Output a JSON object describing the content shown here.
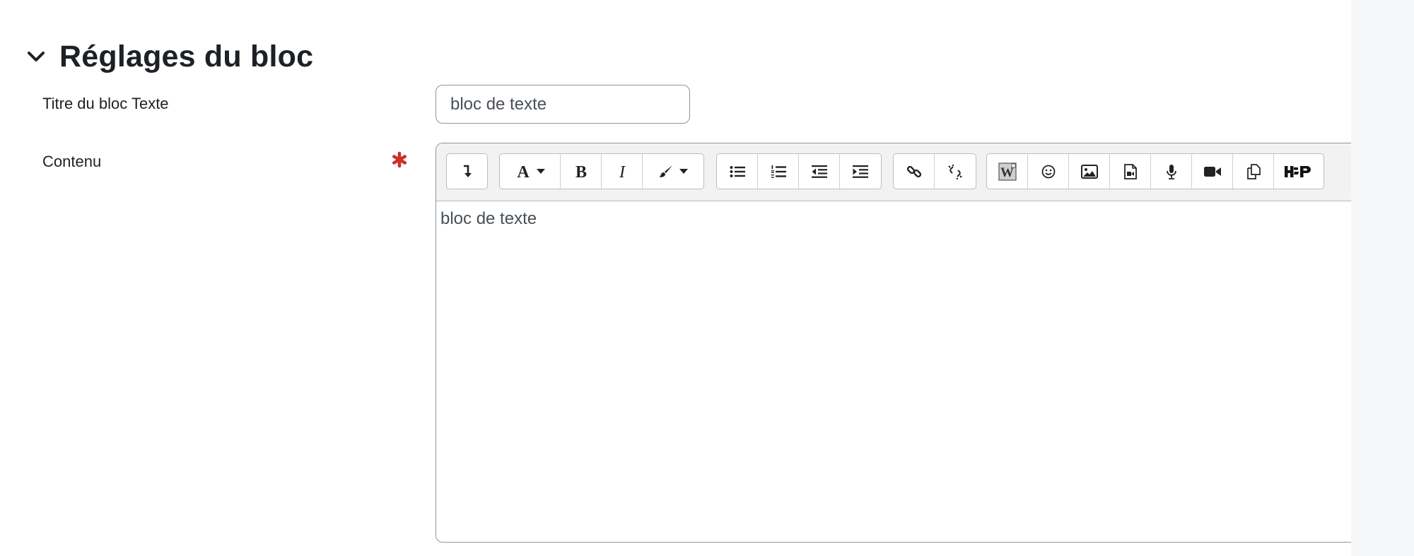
{
  "section": {
    "title": "Réglages du bloc"
  },
  "fields": {
    "title_label": "Titre du bloc Texte",
    "title_value": "bloc de texte",
    "content_label": "Contenu",
    "content_text": "bloc de texte"
  },
  "toolbar": {
    "groups": [
      {
        "items": [
          "collapse-icon"
        ]
      },
      {
        "items": [
          "font-style-icon",
          "bold-icon",
          "italic-icon",
          "text-color-icon"
        ]
      },
      {
        "items": [
          "unordered-list-icon",
          "ordered-list-icon",
          "outdent-icon",
          "indent-icon"
        ]
      },
      {
        "items": [
          "link-icon",
          "unlink-icon"
        ]
      },
      {
        "items": [
          "word-import-icon",
          "emoji-icon",
          "image-icon",
          "media-icon",
          "record-audio-icon",
          "record-video-icon",
          "manage-files-icon",
          "h5p-icon"
        ]
      }
    ]
  },
  "colors": {
    "required": "#c9302c",
    "gutter": "#f5f7f9",
    "toolbar_bg": "#f2f2f2"
  }
}
